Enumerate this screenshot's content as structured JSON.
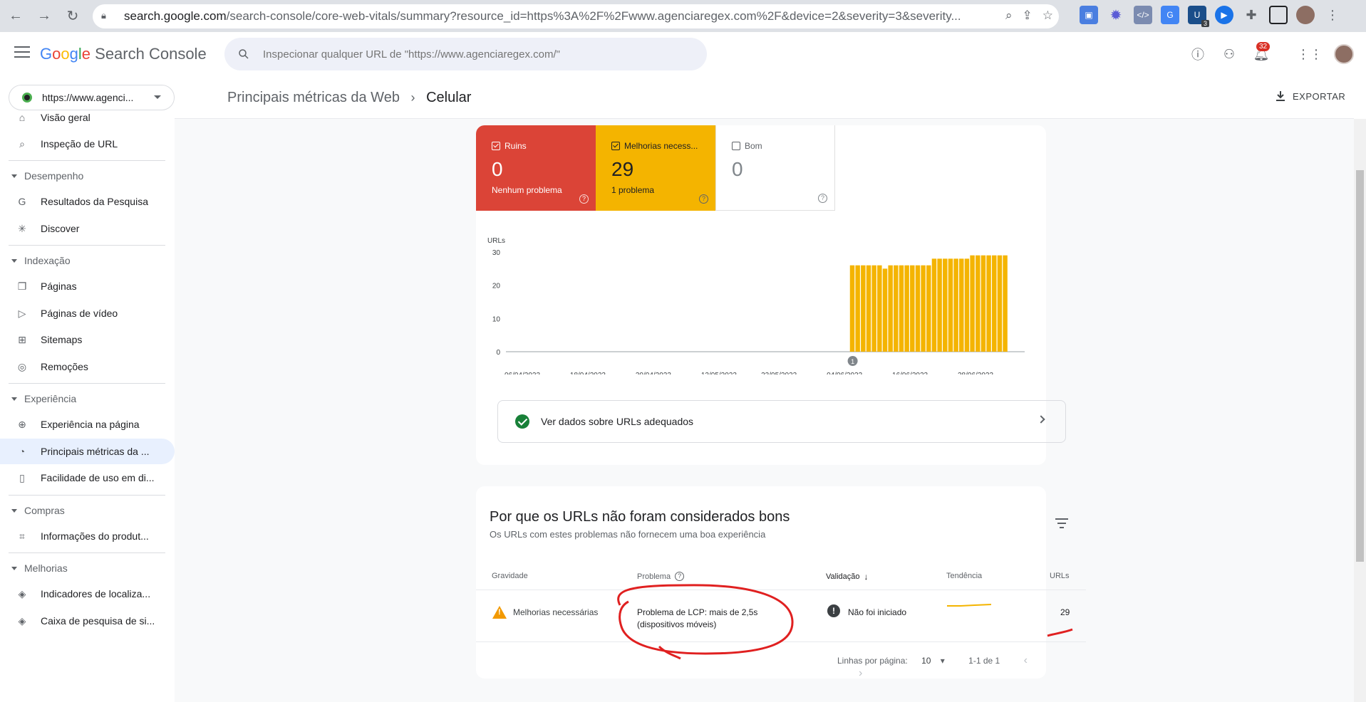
{
  "browser": {
    "url_host": "search.google.com",
    "url_path": "/search-console/core-web-vitals/summary?resource_id=https%3A%2F%2Fwww.agenciaregex.com%2F&device=2&severity=3&severity...",
    "ext_badge": "3",
    "icons": [
      "back-icon",
      "forward-icon",
      "reload-icon",
      "lock-icon",
      "zoom-icon",
      "share-icon",
      "star-icon",
      "puzzle-icon",
      "sidepanel-icon"
    ]
  },
  "app": {
    "logo_google": "Google",
    "logo_product": "Search Console",
    "search_placeholder": "Inspecionar qualquer URL de \"https://www.agenciaregex.com/\"",
    "notif_count": "32"
  },
  "sidebar": {
    "property": "https://www.agenci...",
    "items": [
      {
        "label": "Visão geral",
        "icon": "home-icon"
      },
      {
        "label": "Inspeção de URL",
        "icon": "search-icon"
      }
    ],
    "sections": [
      {
        "title": "Desempenho",
        "items": [
          {
            "label": "Resultados da Pesquisa",
            "icon": "google-g-icon"
          },
          {
            "label": "Discover",
            "icon": "asterisk-icon"
          }
        ]
      },
      {
        "title": "Indexação",
        "items": [
          {
            "label": "Páginas",
            "icon": "pages-icon"
          },
          {
            "label": "Páginas de vídeo",
            "icon": "video-pages-icon"
          },
          {
            "label": "Sitemaps",
            "icon": "sitemap-icon"
          },
          {
            "label": "Remoções",
            "icon": "eye-off-icon"
          }
        ]
      },
      {
        "title": "Experiência",
        "items": [
          {
            "label": "Experiência na página",
            "icon": "plus-circle-icon"
          },
          {
            "label": "Principais métricas da ...",
            "icon": "gauge-icon"
          },
          {
            "label": "Facilidade de uso em di...",
            "icon": "phone-icon"
          }
        ]
      },
      {
        "title": "Compras",
        "items": [
          {
            "label": "Informações do produt...",
            "icon": "tag-icon"
          }
        ]
      },
      {
        "title": "Melhorias",
        "items": [
          {
            "label": "Indicadores de localiza...",
            "icon": "layers-icon"
          },
          {
            "label": "Caixa de pesquisa de si...",
            "icon": "layers-icon"
          }
        ]
      }
    ]
  },
  "header": {
    "crumb_parent": "Principais métricas da Web",
    "crumb_current": "Celular",
    "export": "EXPORTAR"
  },
  "tiles": {
    "poor": {
      "label": "Ruins",
      "value": "0",
      "desc": "Nenhum problema",
      "color": "#db4437"
    },
    "needs": {
      "label": "Melhorias necess...",
      "value": "29",
      "desc": "1 problema",
      "color": "#f4b400"
    },
    "good": {
      "label": "Bom",
      "value": "0"
    }
  },
  "chart_data": {
    "type": "bar",
    "ylabel": "URLs",
    "ylim": [
      0,
      30
    ],
    "yticks": [
      0,
      10,
      20,
      30
    ],
    "xticks": [
      "06/04/2023",
      "18/04/2023",
      "30/04/2023",
      "12/05/2023",
      "23/05/2023",
      "04/06/2023",
      "16/06/2023",
      "28/06/2023"
    ],
    "x_start": "2023-04-03",
    "x_end": "2023-07-07",
    "bar_start": "2023-06-05",
    "values": [
      26,
      26,
      26,
      26,
      26,
      26,
      25,
      26,
      26,
      26,
      26,
      26,
      26,
      26,
      26,
      28,
      28,
      28,
      28,
      28,
      28,
      28,
      29,
      29,
      29,
      29,
      29,
      29,
      29
    ],
    "series_color": "#f4b400",
    "annotation": {
      "date": "2023-06-05",
      "label": "1"
    }
  },
  "good_link": "Ver dados sobre URLs adequados",
  "issues": {
    "title": "Por que os URLs não foram considerados bons",
    "subtitle": "Os URLs com estes problemas não fornecem uma boa experiência",
    "headers": {
      "severity": "Gravidade",
      "problem": "Problema",
      "validation": "Validação",
      "trend": "Tendência",
      "urls": "URLs"
    },
    "rows": [
      {
        "severity": "Melhorias necessárias",
        "problem_1": "Problema de LCP: mais de 2,5s",
        "problem_2": "(dispositivos móveis)",
        "validation": "Não foi iniciado",
        "urls": "29"
      }
    ],
    "pager": {
      "rows_label": "Linhas por página:",
      "rows_value": "10",
      "range": "1-1 de 1"
    }
  }
}
